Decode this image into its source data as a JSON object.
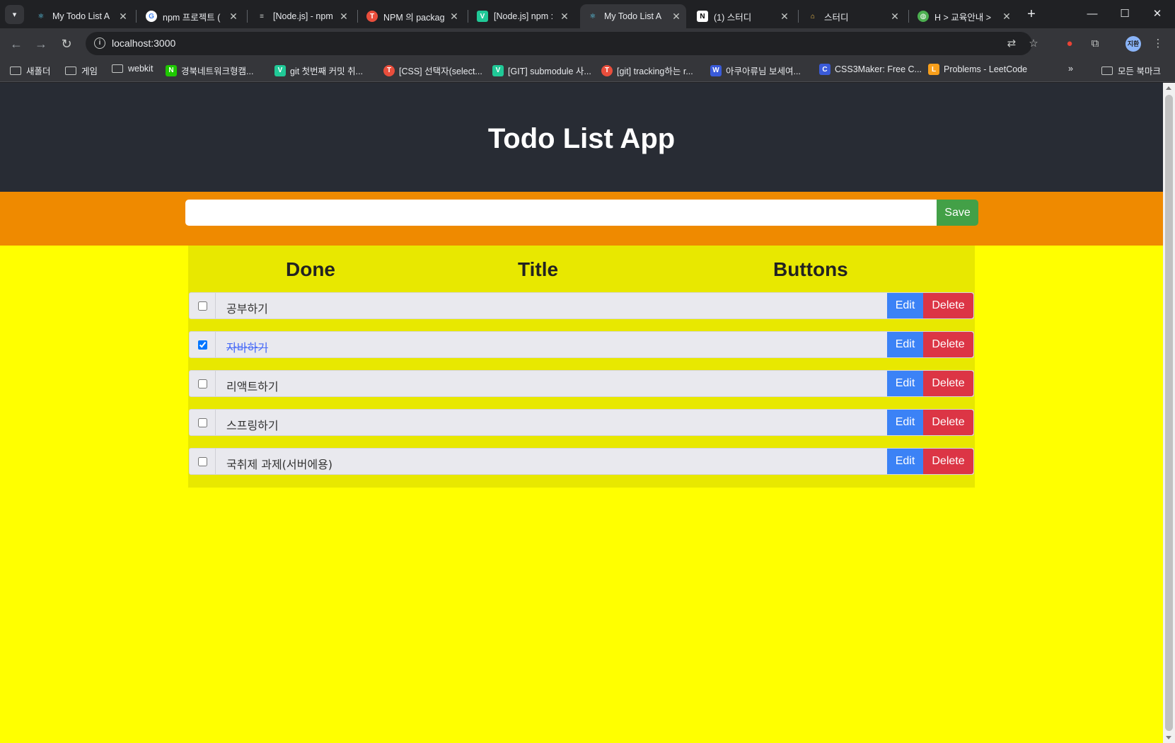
{
  "browser": {
    "tabs": [
      {
        "title": "My Todo List A",
        "favicon": "react-icon",
        "color": "#61dafb",
        "active": false
      },
      {
        "title": "npm 프로젝트 (",
        "favicon": "google-icon",
        "color": "#4285f4",
        "active": false
      },
      {
        "title": "[Node.js] - npm",
        "favicon": "velog-icon",
        "color": "#333333",
        "active": false
      },
      {
        "title": "NPM 의 packag",
        "favicon": "tistory-icon",
        "color": "#e94e3c",
        "active": false
      },
      {
        "title": "[Node.js] npm :",
        "favicon": "v-icon",
        "color": "#20c997",
        "active": false
      },
      {
        "title": "My Todo List A",
        "favicon": "react-icon",
        "color": "#61dafb",
        "active": true
      },
      {
        "title": "(1) 스터디",
        "favicon": "notion-icon",
        "color": "#ffffff",
        "active": false
      },
      {
        "title": "스터디",
        "favicon": "house-icon",
        "color": "#f2c14e",
        "active": false
      },
      {
        "title": "H > 교육안내 >",
        "favicon": "globe-icon",
        "color": "#4caf50",
        "active": false
      }
    ],
    "url": "localhost:3000",
    "bookmarks": [
      {
        "label": "새폴더",
        "type": "folder"
      },
      {
        "label": "게임",
        "type": "folder"
      },
      {
        "label": "webkit",
        "type": "folder"
      },
      {
        "label": "경북네트워크형캠...",
        "type": "site",
        "icon": "N",
        "color": "#1ec800"
      },
      {
        "label": "git 첫번째 커밋 취...",
        "type": "site",
        "icon": "V",
        "color": "#20c997"
      },
      {
        "label": "[CSS] 선택자(select...",
        "type": "site",
        "icon": "T",
        "color": "#e94e3c"
      },
      {
        "label": "[GIT] submodule 사...",
        "type": "site",
        "icon": "V",
        "color": "#20c997"
      },
      {
        "label": "[git] tracking하는 r...",
        "type": "site",
        "icon": "T",
        "color": "#e94e3c"
      },
      {
        "label": "아쿠아류님 보세여...",
        "type": "site",
        "icon": "W",
        "color": "#3a5bd9"
      },
      {
        "label": "CSS3Maker: Free C...",
        "type": "site",
        "icon": "C",
        "color": "#3a5bd9"
      },
      {
        "label": "Problems - LeetCode",
        "type": "site",
        "icon": "L",
        "color": "#f89f1b"
      }
    ],
    "bookmarks_overflow": "»",
    "all_bookmarks": "모든 북마크",
    "profile_initials": "지환"
  },
  "app": {
    "title": "Todo List App",
    "input": {
      "value": "",
      "placeholder": ""
    },
    "save_label": "Save",
    "columns": [
      "Done",
      "Title",
      "Buttons"
    ],
    "todos": [
      {
        "title": "공부하기",
        "done": false
      },
      {
        "title": "자바하기",
        "done": true
      },
      {
        "title": "리액트하기",
        "done": false
      },
      {
        "title": "스프링하기",
        "done": false
      },
      {
        "title": "국취제 과제(서버에용)",
        "done": false
      }
    ],
    "edit_label": "Edit",
    "delete_label": "Delete"
  }
}
